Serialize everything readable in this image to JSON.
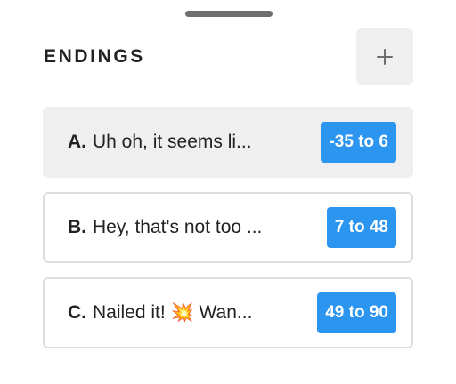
{
  "header": {
    "title": "ENDINGS",
    "add_icon": "plus-icon"
  },
  "colors": {
    "badge": "#2b95f0",
    "selected_card": "#efefef",
    "card_border": "#dedede",
    "text": "#222222"
  },
  "endings": [
    {
      "letter": "A.",
      "text": "Uh oh, it seems li...",
      "range": "-35 to 6",
      "selected": true
    },
    {
      "letter": "B.",
      "text": "Hey, that's not too ...",
      "range": "7 to 48",
      "selected": false
    },
    {
      "letter": "C.",
      "text": "Nailed it! 💥 Wan...",
      "range": "49 to 90",
      "selected": false
    }
  ]
}
